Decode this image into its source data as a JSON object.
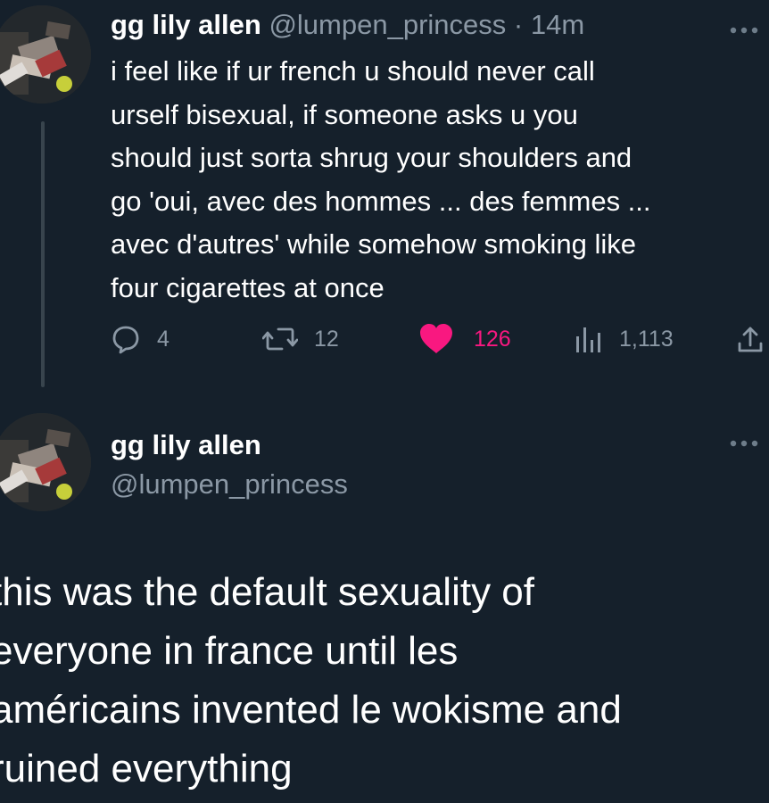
{
  "tweet": {
    "author": {
      "display_name": "gg lily allen",
      "handle": "@lumpen_princess"
    },
    "separator": "·",
    "timestamp": "14m",
    "text": "i feel like if ur french u should never call\nurself bisexual, if someone asks u you\nshould just sorta shrug your shoulders and\ngo 'oui, avec des hommes ... des femmes ...\navec d'autres' while somehow smoking like\nfour cigarettes at once",
    "stats": {
      "replies": "4",
      "retweets": "12",
      "likes": "126",
      "views": "1,113"
    }
  },
  "reply": {
    "author": {
      "display_name": "gg lily allen",
      "handle": "@lumpen_princess"
    },
    "text": "this was the default sexuality of\neveryone in france until les\naméricains invented le wokisme and\nruined everything"
  },
  "colors": {
    "background": "#15202b",
    "text": "#ffffff",
    "secondary": "#8b98a5",
    "like": "#f91880",
    "thread_line": "#38444d"
  },
  "icons": {
    "reply": "speech-bubble-icon",
    "retweet": "retweet-arrows-icon",
    "like": "heart-filled-icon",
    "views": "bar-chart-icon",
    "share": "share-upload-icon",
    "more": "more-dots-icon"
  }
}
